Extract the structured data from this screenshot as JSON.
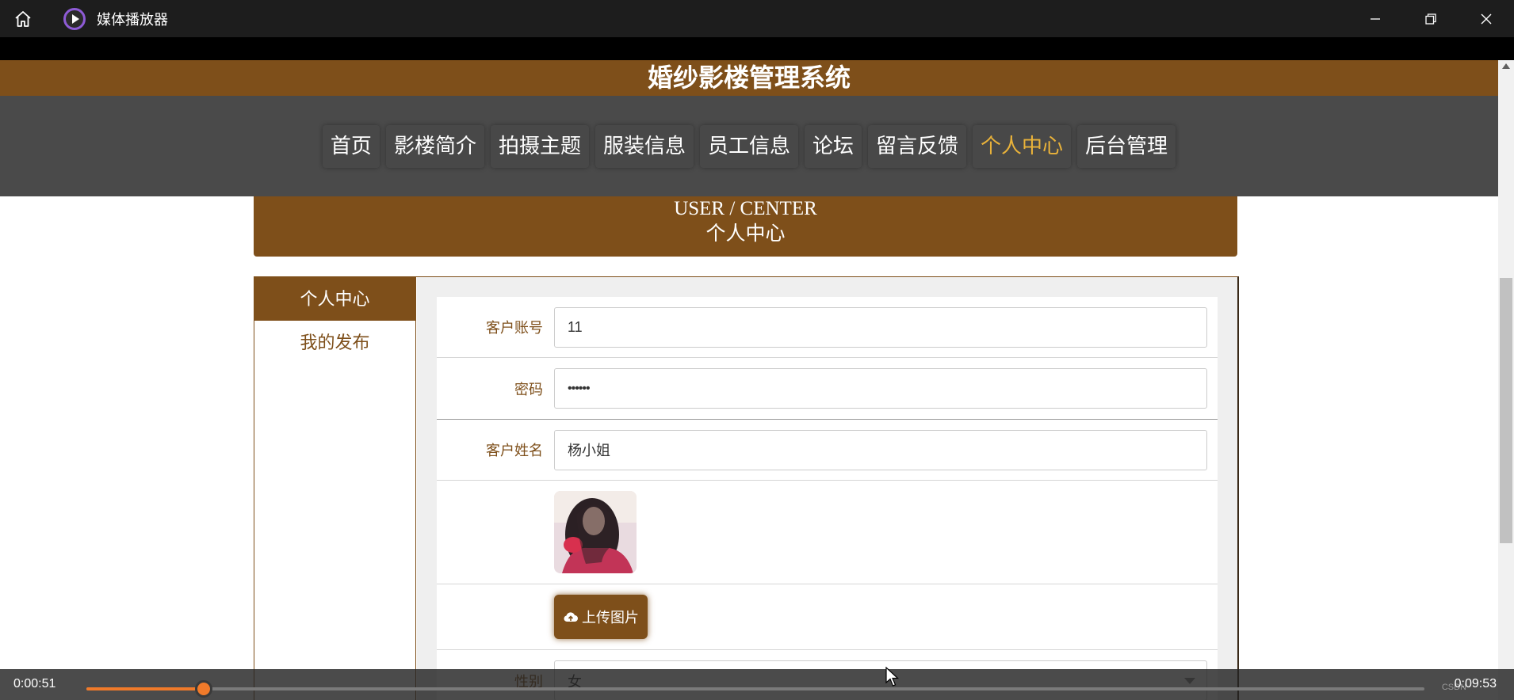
{
  "player": {
    "title": "媒体播放器",
    "current_time": "0:00:51",
    "total_time": "0:09:53",
    "progress": 0.0875,
    "watermark": "CSDN",
    "accent_color": "#f07a2a",
    "icons": [
      "home-icon",
      "media-player-icon",
      "minimize-icon",
      "restore-icon",
      "close-icon"
    ]
  },
  "site": {
    "title": "婚纱影楼管理系统",
    "brand_color": "#7e4f1a",
    "nav": [
      {
        "label": "首页",
        "active": false
      },
      {
        "label": "影楼简介",
        "active": false
      },
      {
        "label": "拍摄主题",
        "active": false
      },
      {
        "label": "服装信息",
        "active": false
      },
      {
        "label": "员工信息",
        "active": false
      },
      {
        "label": "论坛",
        "active": false
      },
      {
        "label": "留言反馈",
        "active": false
      },
      {
        "label": "个人中心",
        "active": true
      },
      {
        "label": "后台管理",
        "active": false
      }
    ]
  },
  "banner": {
    "en": "USER / CENTER",
    "cn": "个人中心"
  },
  "sidebar": {
    "items": [
      {
        "label": "个人中心",
        "active": true
      },
      {
        "label": "我的发布",
        "active": false
      }
    ]
  },
  "form": {
    "account_label": "客户账号",
    "account_value": "11",
    "password_label": "密码",
    "password_value": "••••••",
    "name_label": "客户姓名",
    "name_value": "杨小姐",
    "upload_label": "上传图片",
    "gender_label": "性别",
    "gender_value": "女"
  }
}
